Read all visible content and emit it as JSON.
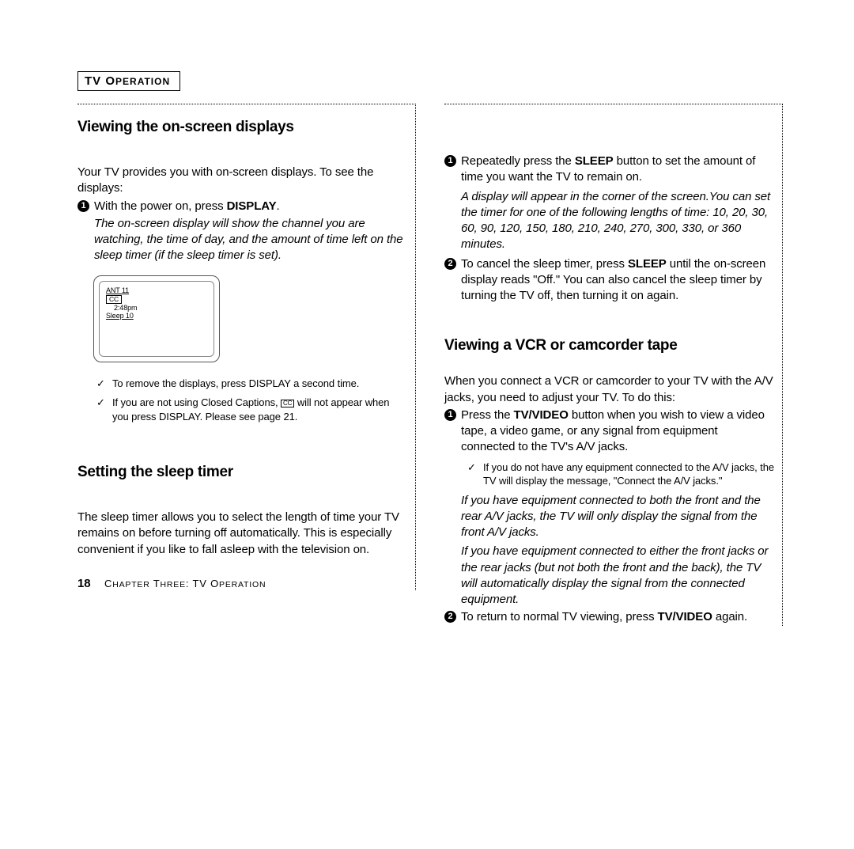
{
  "sectionTag": {
    "pre": "TV O",
    "rest": "PERATION"
  },
  "left": {
    "h1": "Viewing the on-screen displays",
    "intro": "Your TV provides you with on-screen displays. To see the displays:",
    "step1": {
      "a": "With the power on, press ",
      "b": "DISPLAY",
      "c": ".",
      "italic": "The on-screen display will show the channel you are watching, the time of day, and the amount of time left on the sleep timer (if the sleep timer is set)."
    },
    "tv": {
      "ant": "ANT 11",
      "cc": "CC",
      "time": "2:48pm",
      "sleep": "Sleep   10"
    },
    "check1": {
      "a": "To remove the displays, press ",
      "b": "DISPLAY",
      "c": " a second time."
    },
    "check2": {
      "a": "If you are not using Closed Captions, ",
      "cc": "CC",
      "b": " will not appear when you press ",
      "c": "DISPLAY",
      "d": ". Please see page 21."
    },
    "h2": "Setting the sleep timer",
    "sleepPara": "The sleep timer allows you to select the length of time your TV remains on before turning off automatically. This is especially convenient if you like to fall asleep with the television on."
  },
  "right": {
    "r1": {
      "a": "Repeatedly press the ",
      "b": "SLEEP",
      "c": " button to set the amount of time you want the TV to remain on."
    },
    "r1italic": "A display will appear in the corner of the screen.You can set the timer for one of the following lengths of time: 10, 20, 30, 60, 90, 120, 150, 180, 210, 240, 270, 300, 330, or 360 minutes.",
    "r2": {
      "a": "To cancel the sleep timer, press ",
      "b": "SLEEP",
      "c": " until the on-screen display reads \"Off.\" You can also cancel the sleep timer by turning the TV off, then turning it on again."
    },
    "h3": "Viewing a VCR or camcorder tape",
    "vcrIntro": "When you connect a VCR or camcorder to your TV with the A/V jacks, you need to adjust your TV. To do this:",
    "v1": {
      "a": "Press the ",
      "b": "TV/VIDEO",
      "c": " button when you wish to view a video tape, a video game, or any signal from equipment connected to the TV's A/V jacks."
    },
    "vcheck": "If you do not have any equipment connected to the A/V jacks, the TV will display the message, \"Connect the A/V jacks.\"",
    "vitalic1": "If you have equipment connected to both the front and the rear A/V jacks, the TV will only display the signal from the front A/V jacks.",
    "vitalic2": "If you have equipment connected to either the front jacks or the rear jacks (but not both the front and the back), the TV will automatically display the signal from the connected equipment.",
    "v2": {
      "a": "To return to normal TV viewing, press ",
      "b": "TV/VIDEO",
      "c": " again."
    }
  },
  "footer": {
    "page": "18",
    "chapter": {
      "pre": "C",
      "a": "HAPTER",
      "mid1": " T",
      "b": "HREE",
      "sep": ": TV O",
      "c": "PERATION"
    }
  }
}
